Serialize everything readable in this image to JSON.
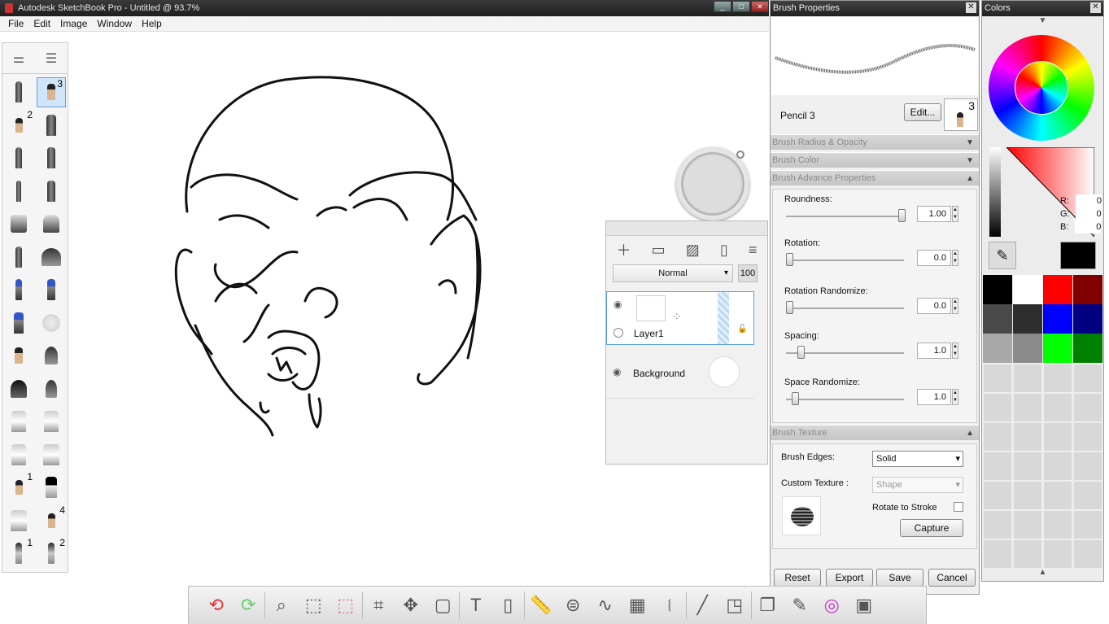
{
  "window": {
    "title": "Autodesk SketchBook Pro - Untitled @ 93.7%"
  },
  "menu": [
    "File",
    "Edit",
    "Image",
    "Window",
    "Help"
  ],
  "toolbox": {
    "brush_numbers": {
      "pencil_3": "3",
      "pencil_2": "2",
      "pencil_1": "1",
      "pencil_4": "4",
      "pen_1": "1",
      "pen_2": "2"
    }
  },
  "layers": {
    "blend_mode": "Normal",
    "opacity": "100",
    "items": [
      {
        "name": "Layer1"
      },
      {
        "name": "Background"
      }
    ]
  },
  "brush_properties": {
    "title": "Brush Properties",
    "brush_name": "Pencil 3",
    "edit_label": "Edit...",
    "preset_number": "3",
    "sections": {
      "radius_opacity": "Brush Radius & Opacity",
      "color": "Brush Color",
      "advance": "Brush Advance Properties",
      "texture": "Brush Texture"
    },
    "sliders": [
      {
        "label": "Roundness:",
        "value": "1.00",
        "fraction": 1.0
      },
      {
        "label": "Rotation:",
        "value": "0.0",
        "fraction": 0.0
      },
      {
        "label": "Rotation Randomize:",
        "value": "0.0",
        "fraction": 0.0
      },
      {
        "label": "Spacing:",
        "value": "1.0",
        "fraction": 0.1
      },
      {
        "label": "Space Randomize:",
        "value": "1.0",
        "fraction": 0.05
      }
    ],
    "brush_edges_label": "Brush Edges:",
    "brush_edges_value": "Solid",
    "custom_texture_label": "Custom Texture :",
    "custom_texture_value": "Shape",
    "rotate_to_stroke": "Rotate to Stroke",
    "capture": "Capture",
    "buttons": {
      "reset": "Reset",
      "export": "Export",
      "save": "Save",
      "cancel": "Cancel"
    }
  },
  "colors": {
    "title": "Colors",
    "r_label": "R:",
    "g_label": "G:",
    "b_label": "B:",
    "r": "0",
    "g": "0",
    "b": "0",
    "current": "#000000",
    "swatches": [
      "#000000",
      "#ffffff",
      "#ff0000",
      "#800000",
      "#4a4a4a",
      "#2e2e2e",
      "#0000ff",
      "#000080",
      "#a8a8a8",
      "#8a8a8a",
      "#00ff00",
      "#008000"
    ]
  }
}
